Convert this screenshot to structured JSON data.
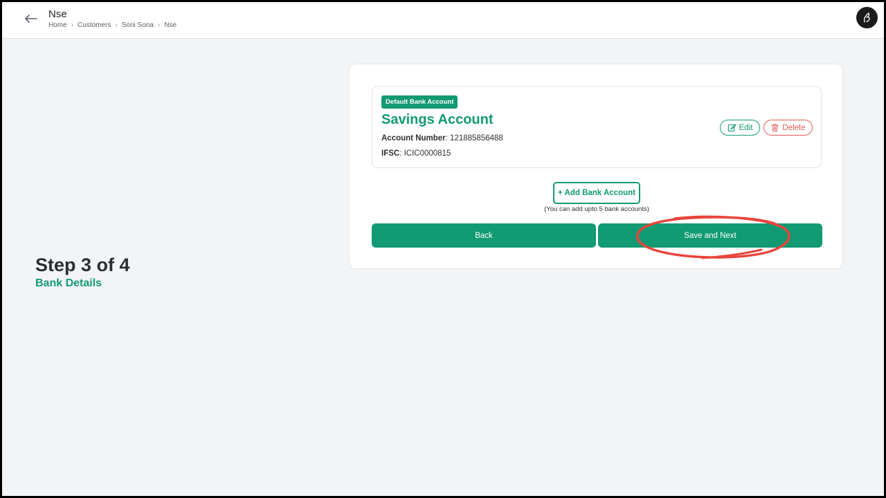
{
  "header": {
    "title": "Nse",
    "breadcrumb": [
      "Home",
      "Customers",
      "Soni Sona",
      "Nse"
    ],
    "back_icon": "arrow-left-icon",
    "avatar_icon": "hand-logo-icon"
  },
  "step": {
    "title": "Step 3 of 4",
    "subtitle": "Bank Details"
  },
  "account": {
    "badge": "Default Bank Account",
    "type": "Savings Account",
    "number_label": "Account Number",
    "number_value": ": 121885856488",
    "ifsc_label": "IFSC",
    "ifsc_value": ": ICIC0000815",
    "edit_label": "Edit",
    "delete_label": "Delete"
  },
  "actions": {
    "add_label": "+ Add Bank Account",
    "add_note": "(You can add upto 5 bank accounts)",
    "back_label": "Back",
    "next_label": "Save and Next"
  },
  "colors": {
    "accent": "#129a72",
    "danger": "#e05a52",
    "annotation": "#e8453c",
    "background": "#f3f4f6"
  }
}
